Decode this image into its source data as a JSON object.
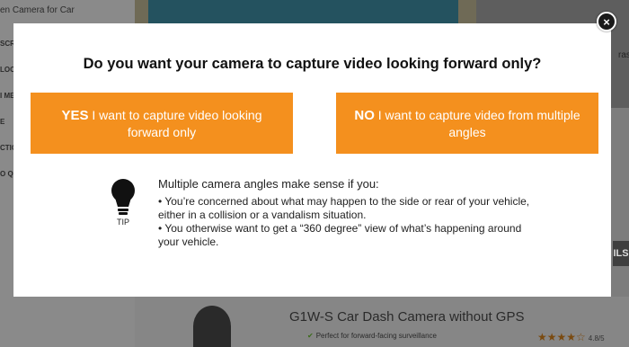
{
  "background": {
    "breadcrumb": "en Camera for Car",
    "side_labels": [
      "SCR",
      "LOC",
      "I ME",
      "E",
      "CTIO",
      "O Q"
    ],
    "right_text": "ras",
    "right_tab": "ILS",
    "product": {
      "title": "G1W-S Car Dash Camera without GPS",
      "subtitle": "Perfect for forward-facing surveillance",
      "stars": "★★★★☆",
      "rating_count": "4.8/5"
    }
  },
  "modal": {
    "question": "Do you want your camera to capture video looking forward only?",
    "yes_button": {
      "lead": "YES",
      "text": " I want to capture video looking forward only"
    },
    "no_button": {
      "lead": "NO",
      "text": " I want to capture video from multiple angles"
    },
    "tip": {
      "label": "TIP",
      "heading": "Multiple camera angles make sense if you:",
      "items": [
        "• You’re concerned about what may happen to the side or rear of your vehicle, either in a collision or a vandalism situation.",
        "• You otherwise want to get a “360 degree” view of what’s happening around your vehicle."
      ]
    },
    "close_icon": "×"
  },
  "colors": {
    "accent": "#f4901e",
    "overlay": "#7d7d7d"
  }
}
